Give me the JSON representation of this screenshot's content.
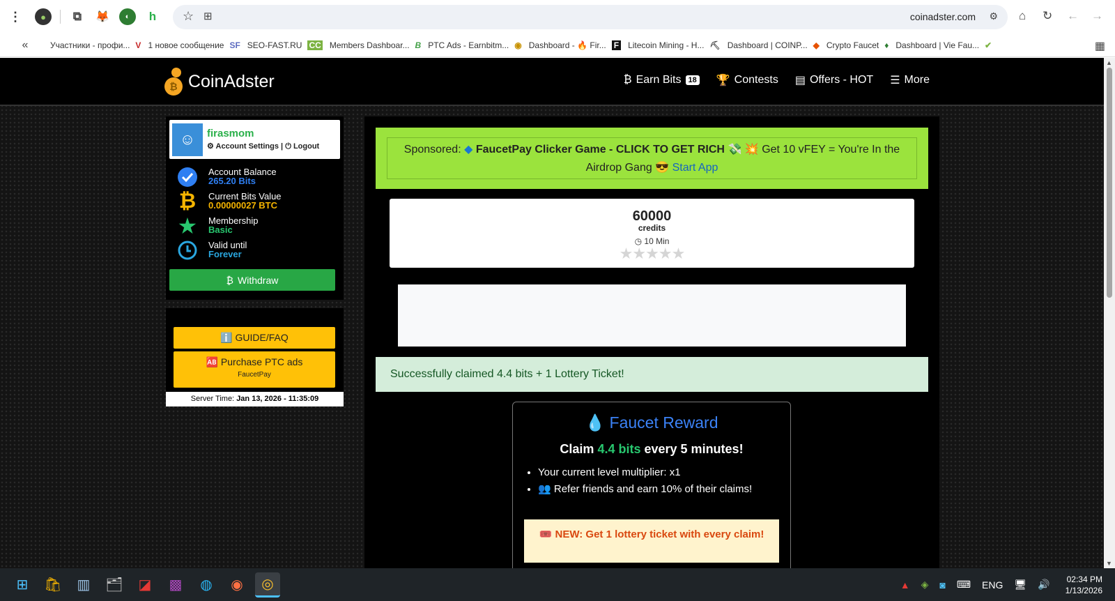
{
  "browser": {
    "url": "coinadster.com",
    "bookmarks": [
      {
        "label": "Участники - профи...",
        "icon": "SP"
      },
      {
        "label": "1 новое сообщение",
        "icon": "V"
      },
      {
        "label": "SEO-FAST.RU",
        "icon": "SF"
      },
      {
        "label": "Members Dashboar...",
        "icon": "CC"
      },
      {
        "label": "PTC Ads - Earnbitm...",
        "icon": "B"
      },
      {
        "label": "Dashboard - 🔥 Fir...",
        "icon": "F"
      },
      {
        "label": "Litecoin Mining - H...",
        "icon": "M"
      },
      {
        "label": "Dashboard | COINP...",
        "icon": "C"
      },
      {
        "label": "Crypto Faucet",
        "icon": "CF"
      },
      {
        "label": "Dashboard | Vie Fau...",
        "icon": "V"
      }
    ]
  },
  "site": {
    "logo_text": "CoinAdster",
    "nav": {
      "earn_bits": "Earn Bits",
      "earn_bits_badge": "18",
      "contests": "Contests",
      "offers": "Offers - HOT",
      "more": "More"
    }
  },
  "sidebar": {
    "username": "firasmom",
    "account_settings": "Account Settings",
    "divider": "|",
    "logout": "Logout",
    "stats": [
      {
        "label": "Account Balance",
        "value": "265.20 Bits",
        "color": "#2f7ff2",
        "icon": "check-circle-icon"
      },
      {
        "label": "Current Bits Value",
        "value": "0.00000027 BTC",
        "color": "#f5b400",
        "icon": "bitcoin-icon"
      },
      {
        "label": "Membership",
        "value": "Basic",
        "color": "#28c76f",
        "icon": "star-icon"
      },
      {
        "label": "Valid until",
        "value": "Forever",
        "color": "#2aa7e0",
        "icon": "clock-icon"
      }
    ],
    "withdraw": "Withdraw",
    "guide": "GUIDE/FAQ",
    "purchase_ptc": "Purchase PTC ads",
    "purchase_ptc_sub": "FaucetPay",
    "server_time_label": "Server Time:",
    "server_time_value": "Jan 13, 2026 - 11:35:09"
  },
  "main": {
    "sponsored_label": "Sponsored:",
    "sponsored_title": "FaucetPay Clicker Game - CLICK TO GET RICH",
    "sponsored_text": "Get 10 vFEY = You're In the Airdrop Gang",
    "sponsored_link": "Start App",
    "offer": {
      "credits": "60000",
      "credits_label": "credits",
      "duration": "10 Min",
      "rating": 0
    },
    "success_message": "Successfully claimed 4.4 bits + 1 Lottery Ticket!",
    "faucet": {
      "title": "Faucet Reward",
      "claim_prefix": "Claim",
      "claim_amount": "4.4 bits",
      "claim_suffix": "every 5 minutes!",
      "multiplier": "Your current level multiplier: x1",
      "referral": "Refer friends and earn 10% of their claims!",
      "lottery": "NEW: Get 1 lottery ticket with every claim!"
    }
  },
  "taskbar": {
    "language": "ENG",
    "time": "02:34 PM",
    "date": "1/13/2026"
  }
}
